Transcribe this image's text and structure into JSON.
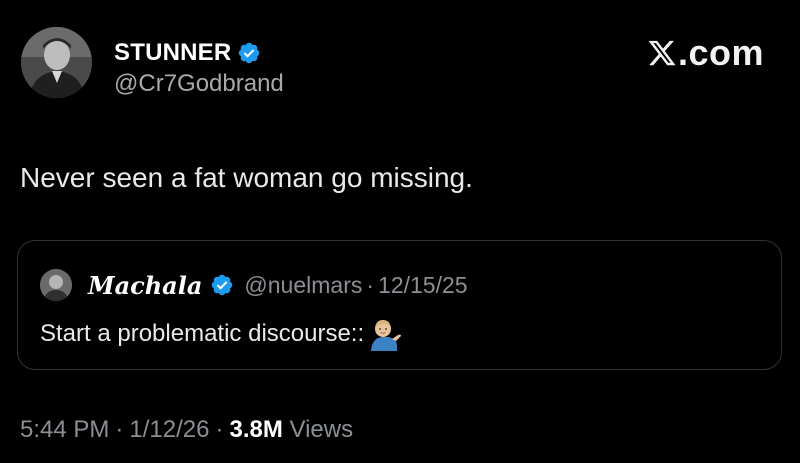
{
  "author": {
    "display_name": "STUNNER",
    "handle": "@Cr7Godbrand",
    "avatar_icon": "profile-photo",
    "verified_icon": "verified-badge-icon"
  },
  "brand": {
    "label": ".com",
    "logo_icon": "x-logo-icon"
  },
  "tweet": {
    "text": "Never seen a fat woman go missing."
  },
  "quote": {
    "display_name": "𝑴𝒂𝒄𝒉𝒂𝒍𝒂",
    "handle": "@nuelmars",
    "separator": "·",
    "date": "12/15/25",
    "text": "Start a problematic discourse::",
    "emoji_icon": "person-tipping-hand-emoji"
  },
  "footer": {
    "time": "5:44 PM",
    "separator": "·",
    "date": "1/12/26",
    "views_count": "3.8M",
    "views_label": "Views"
  },
  "colors": {
    "background": "#000000",
    "text_primary": "#e7e9ea",
    "text_secondary": "#8b8f94",
    "verified_blue": "#1d9bf0",
    "card_border": "#2f3336"
  }
}
